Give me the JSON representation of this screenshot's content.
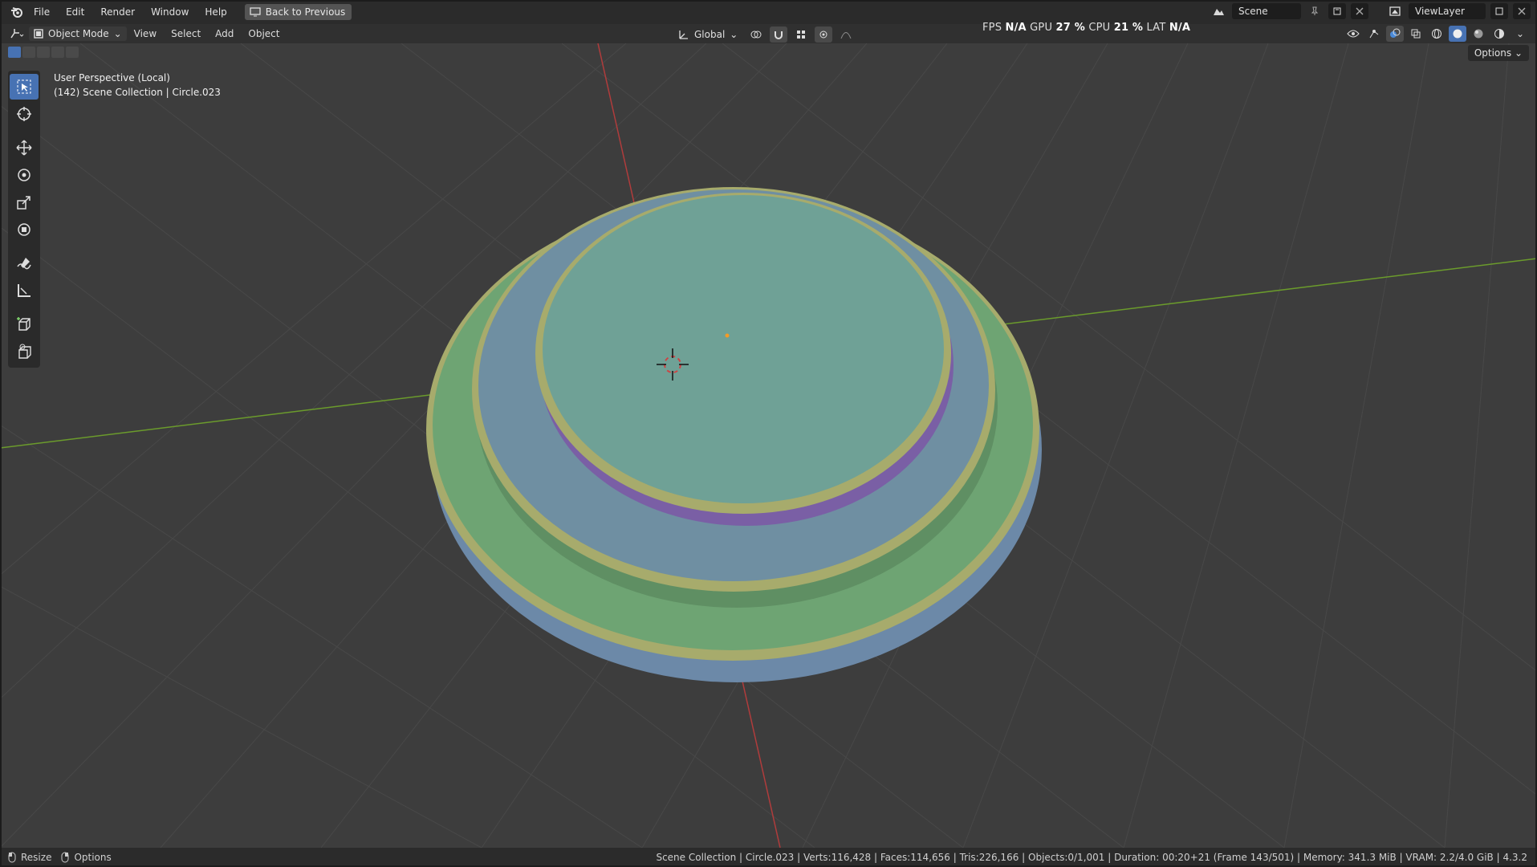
{
  "menu": {
    "items": [
      "File",
      "Edit",
      "Render",
      "Window",
      "Help"
    ],
    "back_button": "Back to Previous"
  },
  "top_right": {
    "scene": "Scene",
    "view_layer": "ViewLayer"
  },
  "header": {
    "mode": "Object Mode",
    "menus": [
      "View",
      "Select",
      "Add",
      "Object"
    ],
    "orientation": "Global",
    "stats": {
      "fps_label": "FPS",
      "fps_value": "N/A",
      "gpu_label": "GPU",
      "gpu_value": "27 %",
      "cpu_label": "CPU",
      "cpu_value": "21 %",
      "lat_label": "LAT",
      "lat_value": "N/A"
    },
    "options": "Options"
  },
  "viewport": {
    "perspective": "User Perspective (Local)",
    "collection": "(142) Scene Collection | Circle.023"
  },
  "status": {
    "resize": "Resize",
    "options": "Options",
    "info": "Scene Collection | Circle.023 | Verts:116,428 | Faces:114,656 | Tris:226,166 | Objects:0/1,001 | Duration: 00:20+21 (Frame 143/501) | Memory: 341.3 MiB | VRAM: 2.2/4.0 GiB | 4.3.2"
  },
  "colors": {
    "accent": "#4772b3",
    "x_axis": "#b03c3c",
    "y_axis": "#6b9b2c",
    "ring_yellow": "#a8aa6a",
    "ring_green": "#6ea473",
    "ring_blue": "#6f8fa2",
    "top_teal": "#6fa196"
  }
}
